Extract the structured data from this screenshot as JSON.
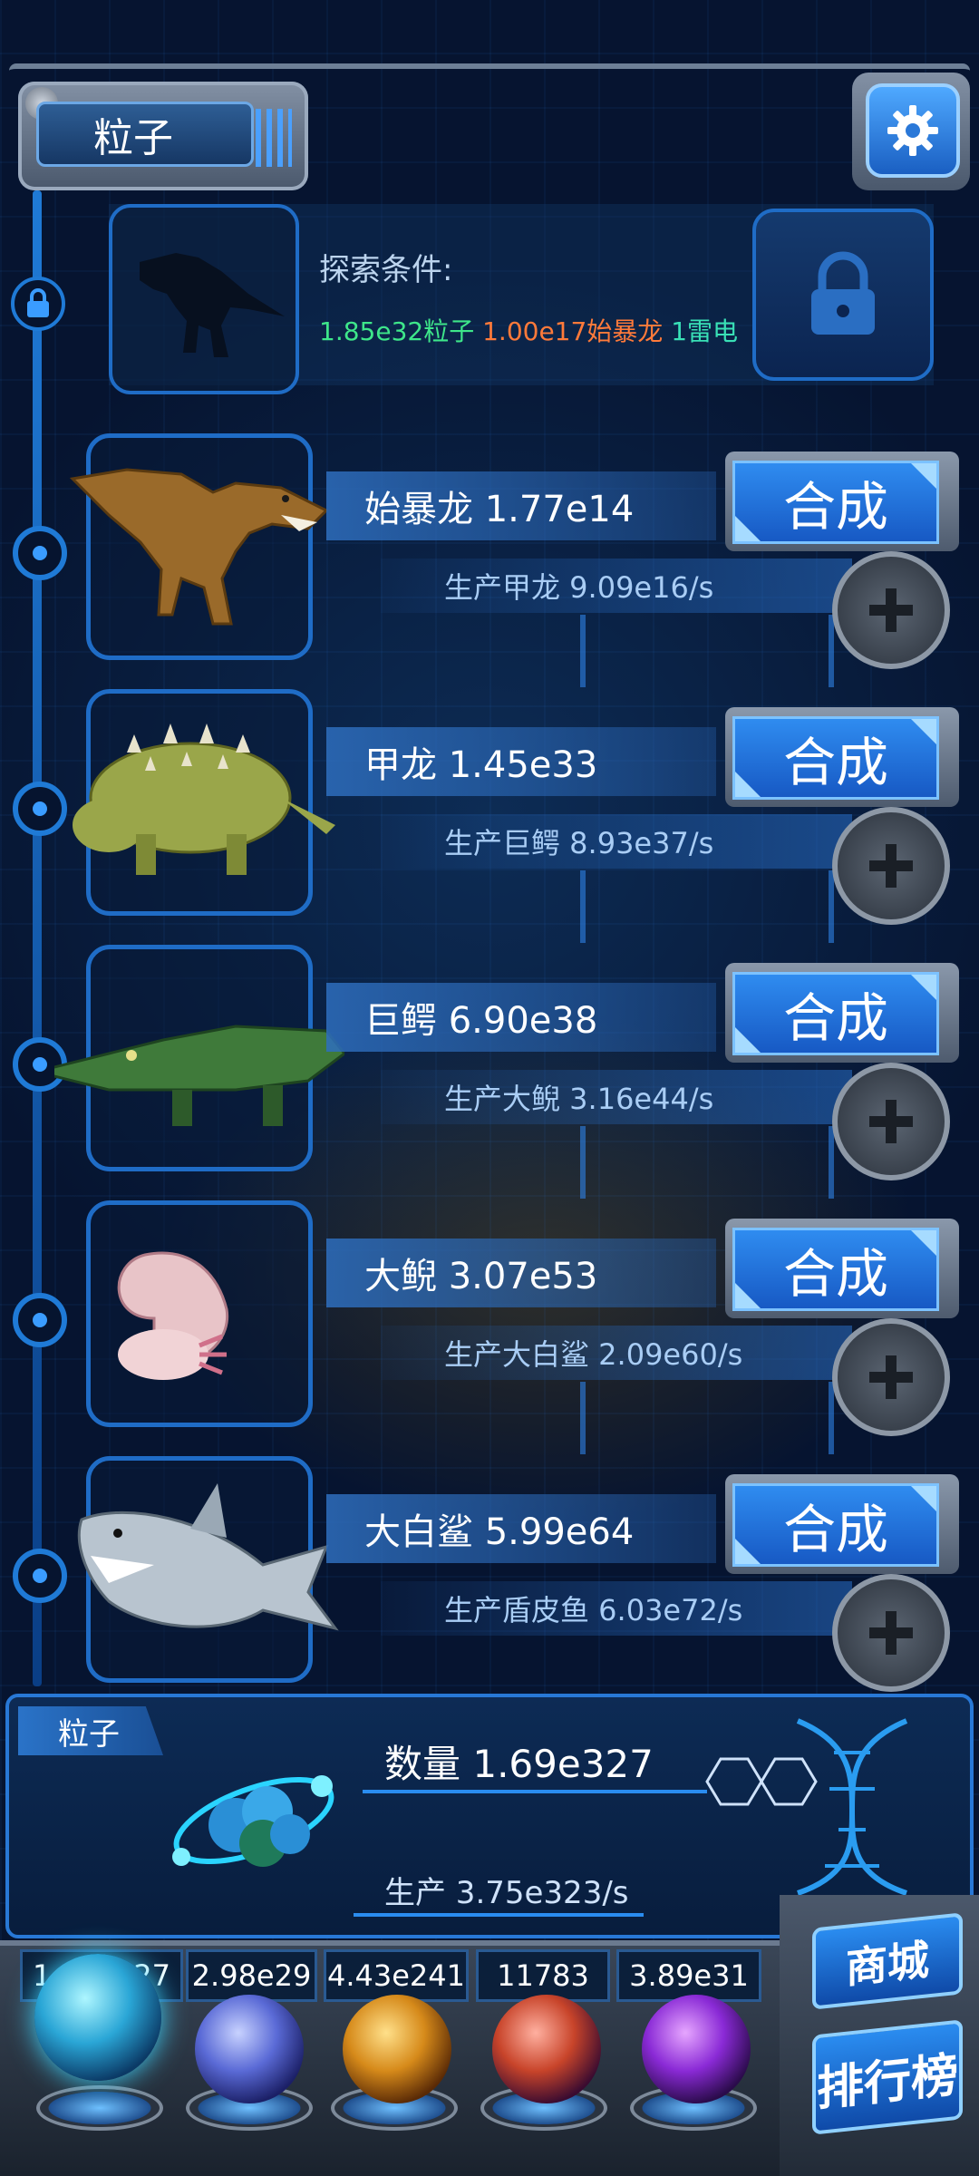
{
  "header": {
    "title": "粒子"
  },
  "explore": {
    "label": "探索条件:",
    "cond1": "1.85e32粒子",
    "cond2": "1.00e17始暴龙",
    "cond3": "1雷电"
  },
  "creatures": [
    {
      "name": "始暴龙 1.77e14",
      "prod": "生产甲龙 9.09e16/s",
      "button": "合成"
    },
    {
      "name": "甲龙 1.45e33",
      "prod": "生产巨鳄 8.93e37/s",
      "button": "合成"
    },
    {
      "name": "巨鳄 6.90e38",
      "prod": "生产大鲵 3.16e44/s",
      "button": "合成"
    },
    {
      "name": "大鲵 3.07e53",
      "prod": "生产大白鲨 2.09e60/s",
      "button": "合成"
    },
    {
      "name": "大白鲨 5.99e64",
      "prod": "生产盾皮鱼 6.03e72/s",
      "button": "合成"
    }
  ],
  "particle": {
    "tag": "粒子",
    "count": "数量 1.69e327",
    "production": "生产 3.75e323/s"
  },
  "resources": [
    {
      "value": "1.69e327"
    },
    {
      "value": "2.98e29"
    },
    {
      "value": "4.43e241"
    },
    {
      "value": "11783"
    },
    {
      "value": "3.89e31"
    }
  ],
  "side": {
    "shop": "商城",
    "rank": "排行榜"
  },
  "colors": {
    "accent": "#2f8cf0",
    "cond_green": "#3ee68a",
    "cond_orange": "#ff7a3a",
    "cond_teal": "#39e0b6"
  }
}
